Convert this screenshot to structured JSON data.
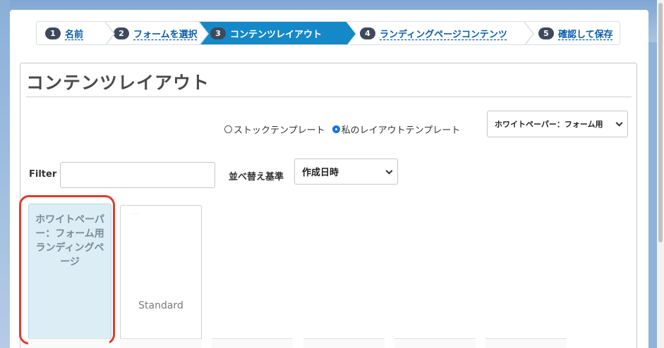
{
  "wizard": {
    "steps": [
      {
        "num": "1",
        "label": "名前",
        "active": false
      },
      {
        "num": "2",
        "label": "フォームを選択",
        "active": false
      },
      {
        "num": "3",
        "label": "コンテンツレイアウト",
        "active": true
      },
      {
        "num": "4",
        "label": "ランディングページコンテンツ",
        "active": false
      },
      {
        "num": "5",
        "label": "確認して保存",
        "active": false
      }
    ]
  },
  "content": {
    "title": "コンテンツレイアウト",
    "radio_stock": "ストックテンプレート",
    "radio_mine": "私のレイアウトテンプレート",
    "template_select_value": "ホワイトペーパー：フォーム用",
    "filter_label": "Filter",
    "filter_value": "",
    "sort_label": "並べ替え基準",
    "sort_select_value": "作成日時"
  },
  "tiles": [
    {
      "label": "ホワイトペーパー：フォーム用ランディングページ",
      "selected": true
    },
    {
      "label": "Standard",
      "selected": false
    }
  ],
  "colors": {
    "accent": "#1589c8",
    "highlight": "#e23a2f",
    "selected_tile": "#dcedf6"
  }
}
